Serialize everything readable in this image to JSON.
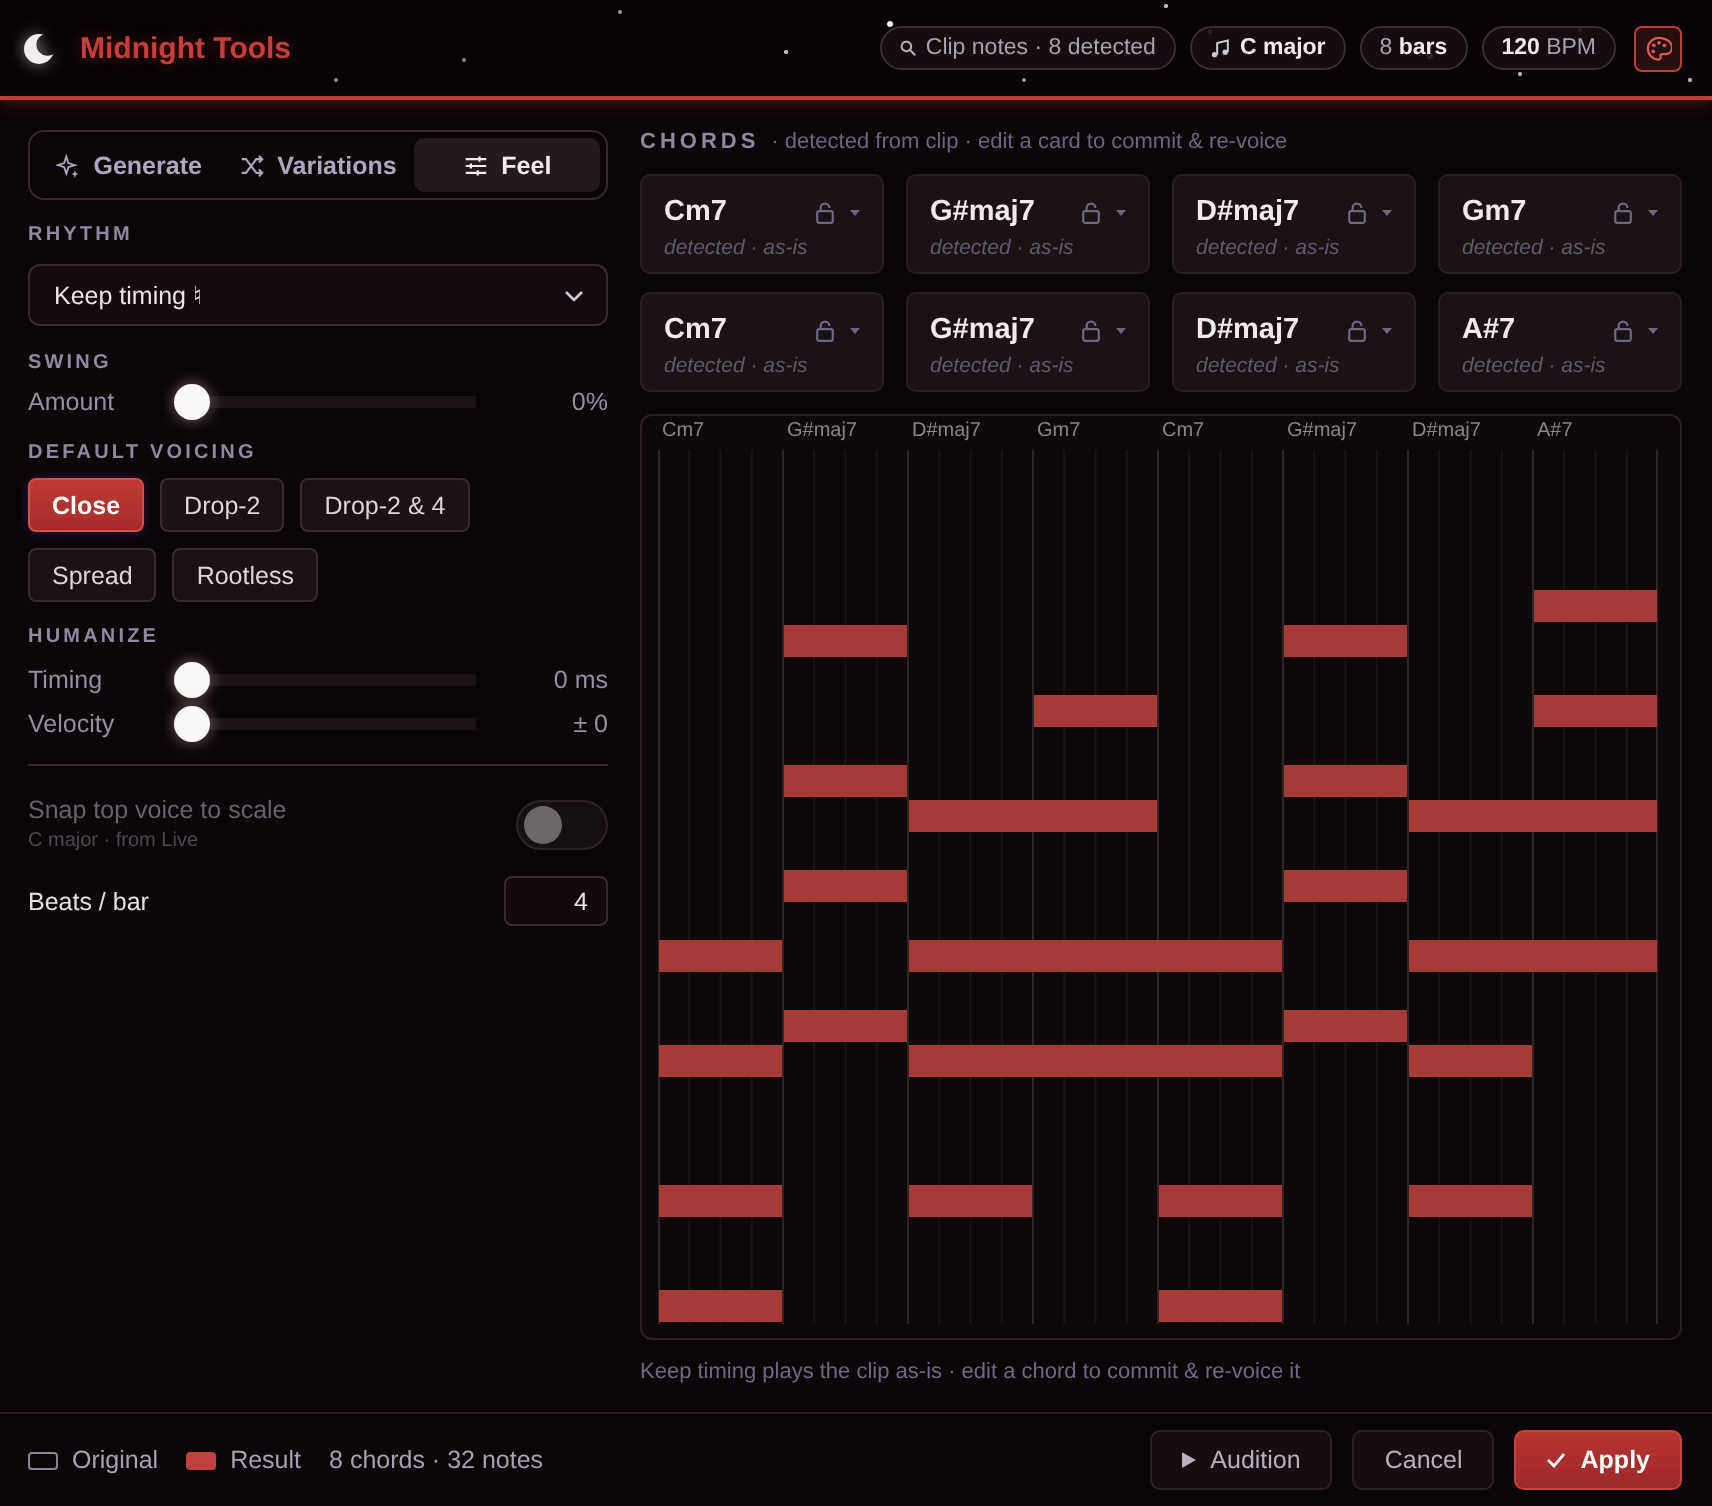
{
  "header": {
    "title": "Midnight Tools",
    "pills": [
      {
        "kind": "clip",
        "text": "Clip notes · 8 detected"
      },
      {
        "kind": "key",
        "text": "C major"
      },
      {
        "kind": "plain",
        "text": "8 **bars**"
      },
      {
        "kind": "plain",
        "text": "**120** BPM"
      }
    ]
  },
  "tabs": [
    {
      "label": "Generate",
      "selected": false
    },
    {
      "label": "Variations",
      "selected": false
    },
    {
      "label": "Feel",
      "selected": true
    }
  ],
  "rhythm": {
    "heading": "RHYTHM",
    "value": "Keep timing ♮"
  },
  "swing": {
    "heading": "SWING",
    "label": "Amount",
    "level": 0,
    "reading": "0%"
  },
  "voicing": {
    "heading": "DEFAULT VOICING",
    "options": [
      {
        "label": "Close",
        "selected": true
      },
      {
        "label": "Drop-2",
        "selected": false
      },
      {
        "label": "Drop-2 & 4",
        "selected": false
      },
      {
        "label": "Spread",
        "selected": false
      },
      {
        "label": "Rootless",
        "selected": false
      }
    ]
  },
  "humanize": {
    "heading": "HUMANIZE",
    "sliders": [
      {
        "label": "Timing",
        "level": 0,
        "reading": "0 ms"
      },
      {
        "label": "Velocity",
        "level": 0,
        "reading": "± 0"
      }
    ]
  },
  "snap": {
    "label": "Snap top voice to scale",
    "note": "C major · from Live",
    "on": false,
    "disabled": true
  },
  "beats_per_bar": {
    "label": "Beats / bar",
    "value": "4"
  },
  "chords": {
    "heading": "CHORDS",
    "note": "· detected from clip · edit a card to commit & re-voice",
    "cards": [
      {
        "name": "Cm7",
        "status": "detected · as-is",
        "locked": false
      },
      {
        "name": "G#maj7",
        "status": "detected · as-is",
        "locked": false
      },
      {
        "name": "D#maj7",
        "status": "detected · as-is",
        "locked": false
      },
      {
        "name": "Gm7",
        "status": "detected · as-is",
        "locked": false
      },
      {
        "name": "Cm7",
        "status": "detected · as-is",
        "locked": false
      },
      {
        "name": "G#maj7",
        "status": "detected · as-is",
        "locked": false
      },
      {
        "name": "D#maj7",
        "status": "detected · as-is",
        "locked": false
      },
      {
        "name": "A#7",
        "status": "detected · as-is",
        "locked": false
      }
    ]
  },
  "roll": {
    "bar_labels": [
      "Cm7",
      "G#maj7",
      "D#maj7",
      "Gm7",
      "Cm7",
      "G#maj7",
      "D#maj7",
      "A#7"
    ]
  },
  "caption": "Keep timing plays the clip as-is · edit a chord to commit & re-voice it",
  "footer": {
    "legend": [
      {
        "label": "Original",
        "kind": "outline"
      },
      {
        "label": "Result",
        "kind": "filled"
      }
    ],
    "summary": "8 chords · 32 notes",
    "buttons": [
      {
        "label": "Audition",
        "kind": "play"
      },
      {
        "label": "Cancel",
        "kind": "plain"
      },
      {
        "label": "Apply",
        "kind": "primary"
      }
    ]
  }
}
